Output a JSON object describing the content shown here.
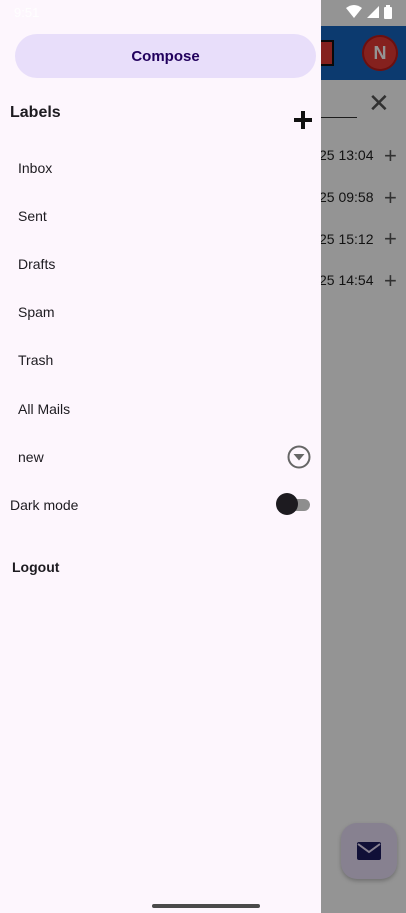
{
  "status_bar": {
    "time": "9:51"
  },
  "background": {
    "avatar_letter": "N",
    "rows": [
      {
        "time": "25 13:04"
      },
      {
        "time": "25 09:58"
      },
      {
        "time": "25 15:12"
      },
      {
        "time": "25 14:54"
      }
    ]
  },
  "drawer": {
    "compose_label": "Compose",
    "labels_title": "Labels",
    "items": [
      {
        "label": "Inbox"
      },
      {
        "label": "Sent"
      },
      {
        "label": "Drafts"
      },
      {
        "label": "Spam"
      },
      {
        "label": "Trash"
      },
      {
        "label": "All Mails"
      },
      {
        "label": "new"
      }
    ],
    "dark_mode_label": "Dark mode",
    "dark_mode_on": false,
    "logout_label": "Logout"
  },
  "colors": {
    "drawer_bg": "#fdf6fd",
    "compose_bg": "#e8defa",
    "appbar": "#1565c0",
    "avatar": "#e53935"
  }
}
